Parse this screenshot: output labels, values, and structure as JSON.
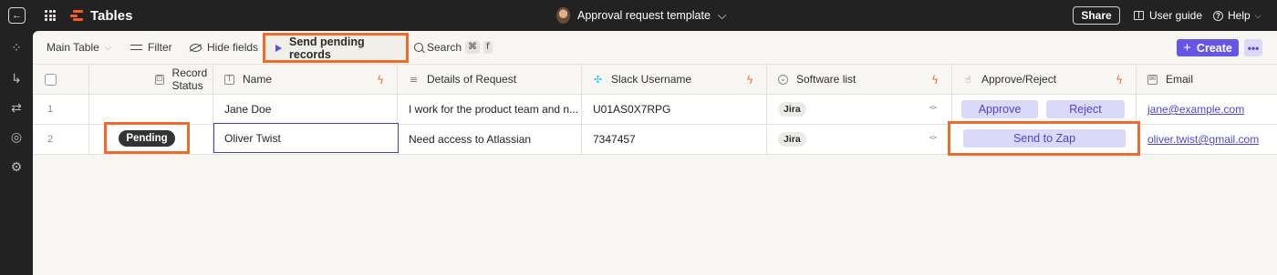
{
  "topbar": {
    "app_title": "Tables",
    "doc_title": "Approval request template",
    "share_label": "Share",
    "guide_label": "User guide",
    "help_label": "Help"
  },
  "toolbar": {
    "view_label": "Main Table",
    "filter_label": "Filter",
    "hide_fields_label": "Hide fields",
    "send_pending_label": "Send pending records",
    "search_label": "Search",
    "search_shortcut_key1": "⌘",
    "search_shortcut_key2": "f",
    "create_label": "Create",
    "more_label": "•••"
  },
  "columns": [
    {
      "label": "Record Status",
      "icon": "lock-icon"
    },
    {
      "label": "Name",
      "icon": "text-icon"
    },
    {
      "label": "Details of Request",
      "icon": "long-text-icon"
    },
    {
      "label": "Slack Username",
      "icon": "slack-icon"
    },
    {
      "label": "Software list",
      "icon": "dropdown-icon"
    },
    {
      "label": "Approve/Reject",
      "icon": "thumbs-up-icon"
    },
    {
      "label": "Email",
      "icon": "mail-icon"
    }
  ],
  "rows": [
    {
      "num": "1",
      "status": "",
      "name": "Jane Doe",
      "details": "I work for the product team and n...",
      "slack": "U01AS0X7RPG",
      "software": "Jira",
      "approve_label": "Approve",
      "reject_label": "Reject",
      "email": "jane@example.com"
    },
    {
      "num": "2",
      "status": "Pending",
      "name": "Oliver Twist",
      "details": "Need access to Atlassian",
      "slack": "7347457",
      "software": "Jira",
      "zap_label": "Send to Zap",
      "email": "oliver.twist@gmail.com"
    }
  ],
  "colors": {
    "accent": "#6656e3",
    "highlight": "#f06a2a",
    "button_bg": "#dcd8f8",
    "topbar_bg": "#222222"
  }
}
